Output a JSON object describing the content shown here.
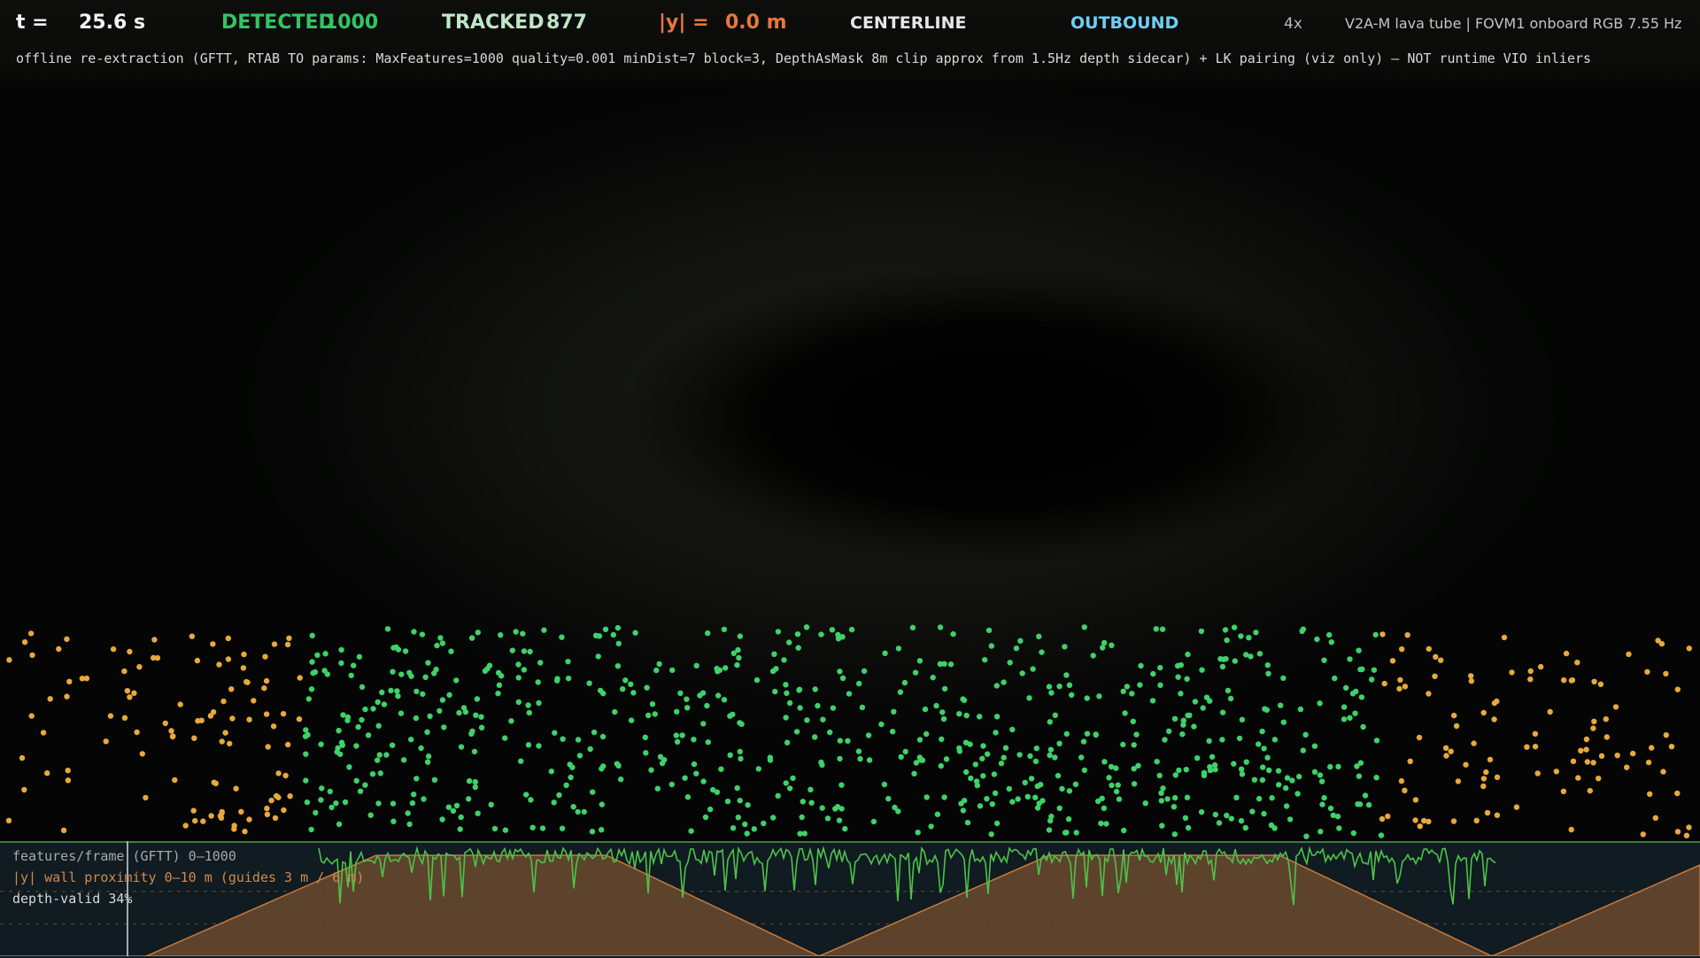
{
  "hud": {
    "time_label": "t =",
    "time_value": "25.6 s",
    "detected_label": "DETECTED",
    "detected_value": "1000",
    "tracked_label": "TRACKED",
    "tracked_value": "877",
    "lateral_label": "|y| =",
    "lateral_value": "0.0 m",
    "mode": "CENTERLINE",
    "direction": "OUTBOUND",
    "speed": "4x",
    "source": "V2A-M lava tube | FOVM1 onboard RGB 7.55 Hz",
    "subtitle": "offline re-extraction (GFTT, RTAB TO params: MaxFeatures=1000 quality=0.001 minDist=7 block=3, DepthAsMask 8m clip approx from 1.5Hz depth sidecar) + LK pairing (viz only) — NOT runtime VIO inliers"
  },
  "colors": {
    "detected": "#32c463",
    "tracked_point": "#3fd16a",
    "untracked_point": "#e8a93a",
    "lateral": "#e8773a",
    "direction": "#6fcff5",
    "wall_fill": "#6b4a2e",
    "wall_line": "#c87a3a",
    "feature_line": "#4ec24a"
  },
  "features": {
    "detected_count": 1000,
    "tracked_count": 877
  },
  "chart": {
    "features_label": "features/frame (GFTT)  0–1000",
    "wall_label": "|y| wall proximity  0–10 m (guides 3 m / 6 m)",
    "depth_label": "depth-valid  34%"
  },
  "chart_data": {
    "type": "line",
    "series": [
      {
        "name": "features/frame (GFTT)",
        "range": [
          0,
          1000
        ]
      },
      {
        "name": "|y| wall proximity",
        "range": [
          0,
          10
        ],
        "unit": "m",
        "guides": [
          3,
          6
        ]
      }
    ]
  }
}
